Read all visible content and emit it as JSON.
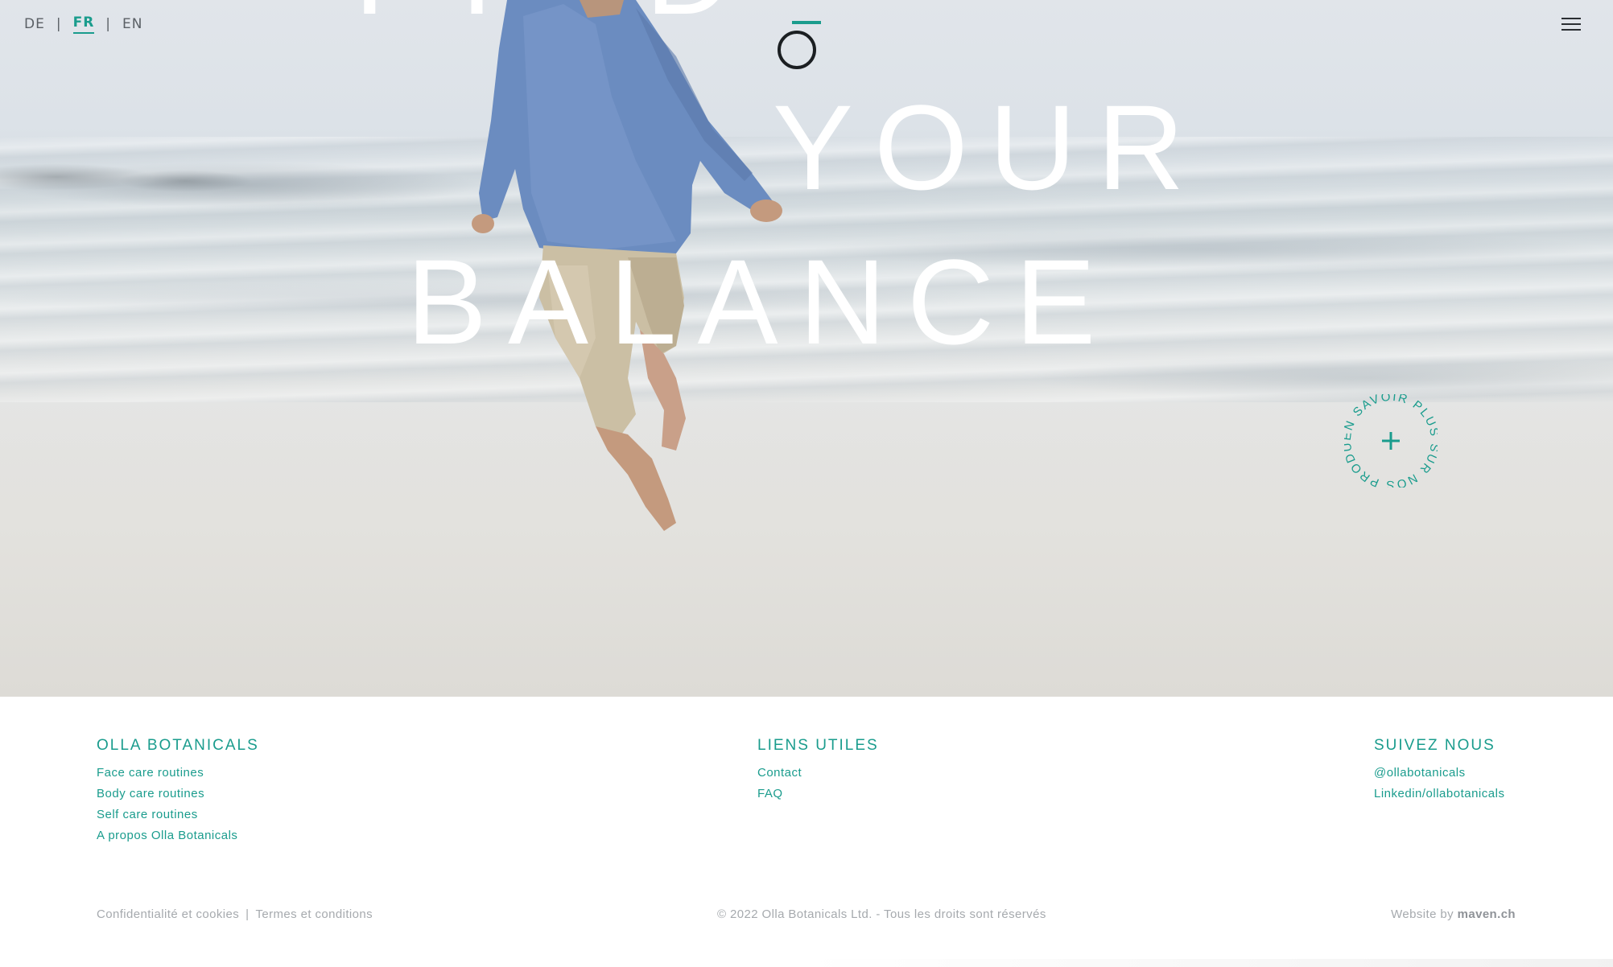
{
  "header": {
    "languages": [
      {
        "code": "DE",
        "active": false
      },
      {
        "code": "FR",
        "active": true
      },
      {
        "code": "EN",
        "active": false
      }
    ],
    "separator": "|",
    "logo_icon": "olla-logo-icon",
    "menu_icon": "hamburger-icon"
  },
  "hero": {
    "headline_line1": "FIND",
    "headline_line2": "YOUR",
    "headline_line3": "BALANCE",
    "badge_text": "EN SAVOIR PLUS SUR NOS PRODUITS",
    "badge_icon": "plus-icon"
  },
  "footer": {
    "columns": [
      {
        "title": "OLLA BOTANICALS",
        "links": [
          "Face care routines",
          "Body care routines",
          "Self care routines",
          "A propos Olla Botanicals"
        ]
      },
      {
        "title": "LIENS UTILES",
        "links": [
          "Contact",
          "FAQ"
        ]
      },
      {
        "title": "SUIVEZ NOUS",
        "links": [
          "@ollabotanicals",
          "Linkedin/ollabotanicals"
        ]
      }
    ],
    "legal": {
      "privacy": "Confidentialité et cookies",
      "separator": "|",
      "terms": "Termes et conditions"
    },
    "copyright": "© 2022 Olla Botanicals Ltd. - Tous les droits sont réservés",
    "credit_prefix": "Website by ",
    "credit_name": "maven.ch"
  },
  "colors": {
    "accent": "#1a9c8d",
    "muted_text": "#a6aaae"
  }
}
